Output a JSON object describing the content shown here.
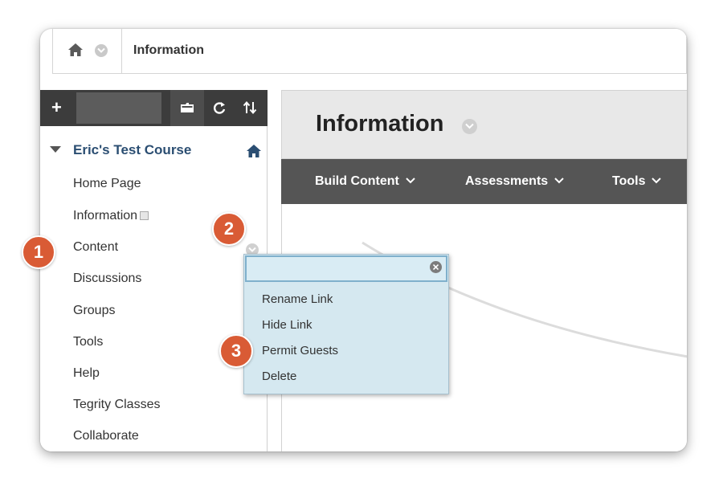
{
  "breadcrumb": {
    "current": "Information"
  },
  "sidebar": {
    "course_title": "Eric's Test Course",
    "toolbar": {
      "add_label": "+"
    },
    "items": [
      {
        "label": "Home Page"
      },
      {
        "label": "Information"
      },
      {
        "label": "Content"
      },
      {
        "label": "Discussions"
      },
      {
        "label": "Groups"
      },
      {
        "label": "Tools"
      },
      {
        "label": "Help"
      },
      {
        "label": "Tegrity Classes"
      },
      {
        "label": "Collaborate"
      }
    ]
  },
  "main": {
    "title": "Information",
    "actions": [
      {
        "label": "Build Content"
      },
      {
        "label": "Assessments"
      },
      {
        "label": "Tools"
      }
    ]
  },
  "context_menu": {
    "search_value": "",
    "items": [
      {
        "label": "Rename Link"
      },
      {
        "label": "Hide Link"
      },
      {
        "label": "Permit Guests"
      },
      {
        "label": "Delete"
      }
    ]
  },
  "callouts": [
    {
      "number": "1"
    },
    {
      "number": "2"
    },
    {
      "number": "3"
    }
  ],
  "colors": {
    "callout": "#d95b35",
    "course_title": "#2b4e72",
    "toolbar": "#3c3c3c",
    "action_bar": "#555555",
    "menu_bg": "#d5e8f0"
  },
  "icons": [
    "home-icon",
    "chevron-down-icon",
    "plus-icon",
    "folder-icon",
    "refresh-icon",
    "sort-icon",
    "collapse-triangle-icon",
    "clear-icon"
  ]
}
